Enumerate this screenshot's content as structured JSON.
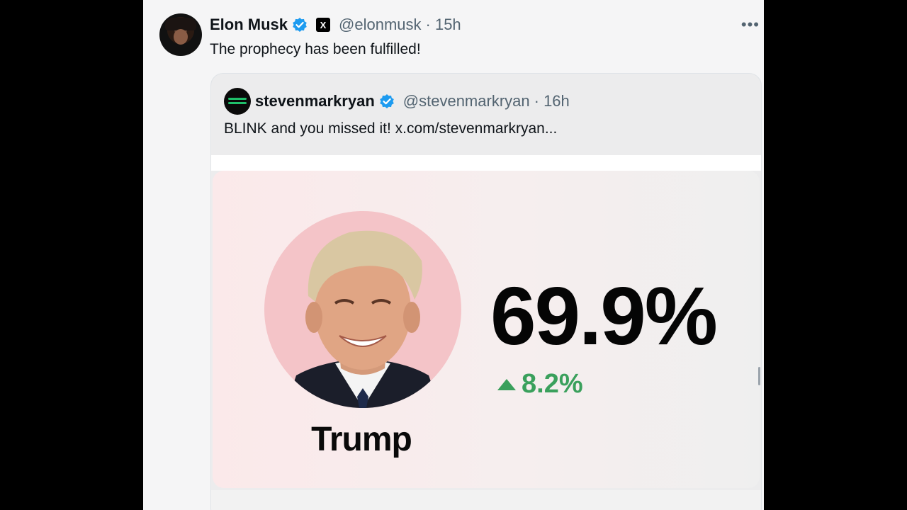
{
  "post": {
    "author_name": "Elon Musk",
    "x_badge": "X",
    "handle": "@elonmusk",
    "time": "· 15h",
    "more": "•••",
    "text": "The prophecy has been fulfilled!"
  },
  "quoted": {
    "author_name": "stevenmarkryan",
    "handle": "@stevenmarkryan",
    "time": "· 16h",
    "text": "BLINK and you missed it!  x.com/stevenmarkryan..."
  },
  "media": {
    "candidate": "Trump",
    "percentage": "69.9%",
    "change": "8.2%"
  },
  "colors": {
    "verified": "#1d9bf0",
    "change_green": "#3aa05c",
    "portrait_bg": "#f4c4c8"
  }
}
